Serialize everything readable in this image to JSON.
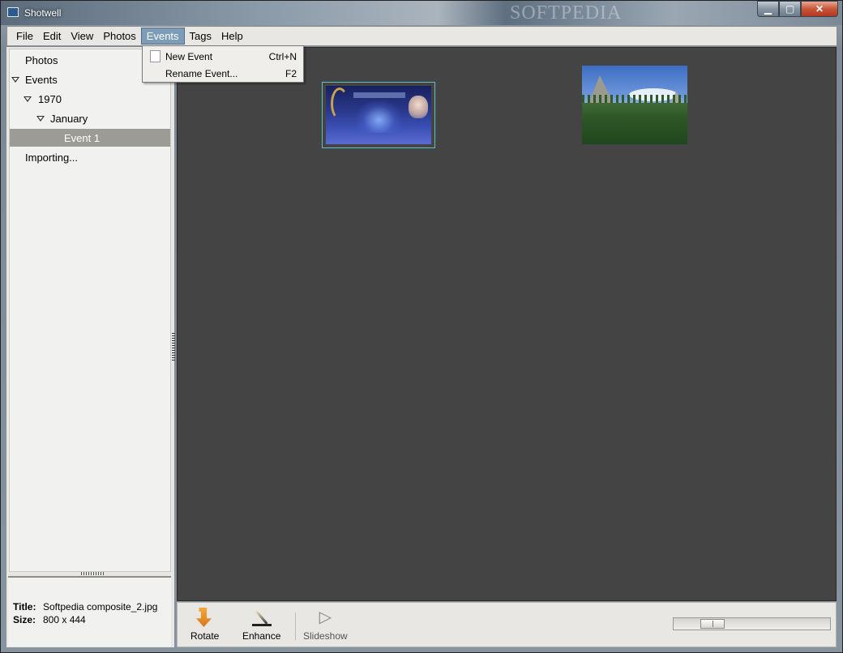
{
  "window": {
    "title": "Shotwell",
    "watermark": "SOFTPEDIA",
    "min_glyph": "▁",
    "max_glyph": "▢",
    "close_glyph": "✕"
  },
  "menubar": {
    "items": [
      "File",
      "Edit",
      "View",
      "Photos",
      "Events",
      "Tags",
      "Help"
    ],
    "active": "Events"
  },
  "events_menu": {
    "items": [
      {
        "label": "New Event",
        "shortcut": "Ctrl+N"
      },
      {
        "label": "Rename Event...",
        "shortcut": "F2"
      }
    ]
  },
  "sidebar": {
    "tree": [
      {
        "label": "Photos",
        "expanded": null
      },
      {
        "label": "Events",
        "expanded": true
      },
      {
        "label": "1970",
        "expanded": true
      },
      {
        "label": "January",
        "expanded": true
      },
      {
        "label": "Event 1",
        "selected": true
      },
      {
        "label": "Importing..."
      }
    ],
    "info": {
      "title_key": "Title:",
      "title_value": "Softpedia composite_2.jpg",
      "size_key": "Size:",
      "size_value": "800 x 444"
    }
  },
  "viewer": {
    "photos": [
      {
        "name": "softpedia-composite-thumbnail",
        "selected": true
      },
      {
        "name": "mountain-forest-thumbnail",
        "selected": false
      }
    ]
  },
  "toolbar": {
    "rotate_label": "Rotate",
    "enhance_label": "Enhance",
    "slideshow_label": "Slideshow",
    "zoom_level": 0.2
  },
  "colors": {
    "viewer_bg": "#444444",
    "selection_border": "#5fc0c8",
    "menu_active": "#7d9cb8"
  }
}
